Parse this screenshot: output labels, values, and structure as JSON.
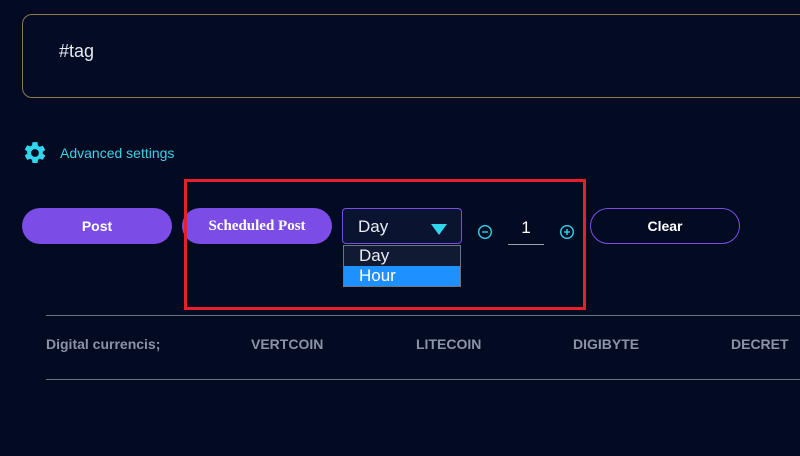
{
  "tag_input": {
    "value": "#tag"
  },
  "advanced_settings": {
    "label": "Advanced settings",
    "icon": "gear-icon"
  },
  "actions": {
    "post_label": "Post",
    "scheduled_post_label": "Scheduled Post",
    "clear_label": "Clear"
  },
  "schedule": {
    "unit_selected": "Day",
    "unit_options": [
      "Day",
      "Hour"
    ],
    "unit_highlighted": "Hour",
    "quantity": "1"
  },
  "currencies": {
    "heading": "Digital currencis;",
    "items": [
      "VERTCOIN",
      "LITECOIN",
      "DIGIBYTE",
      "DECRET"
    ]
  },
  "colors": {
    "background": "#020b22",
    "accent": "#7b4de6",
    "cyan": "#2fd6ee",
    "highlight": "#e8202a"
  }
}
